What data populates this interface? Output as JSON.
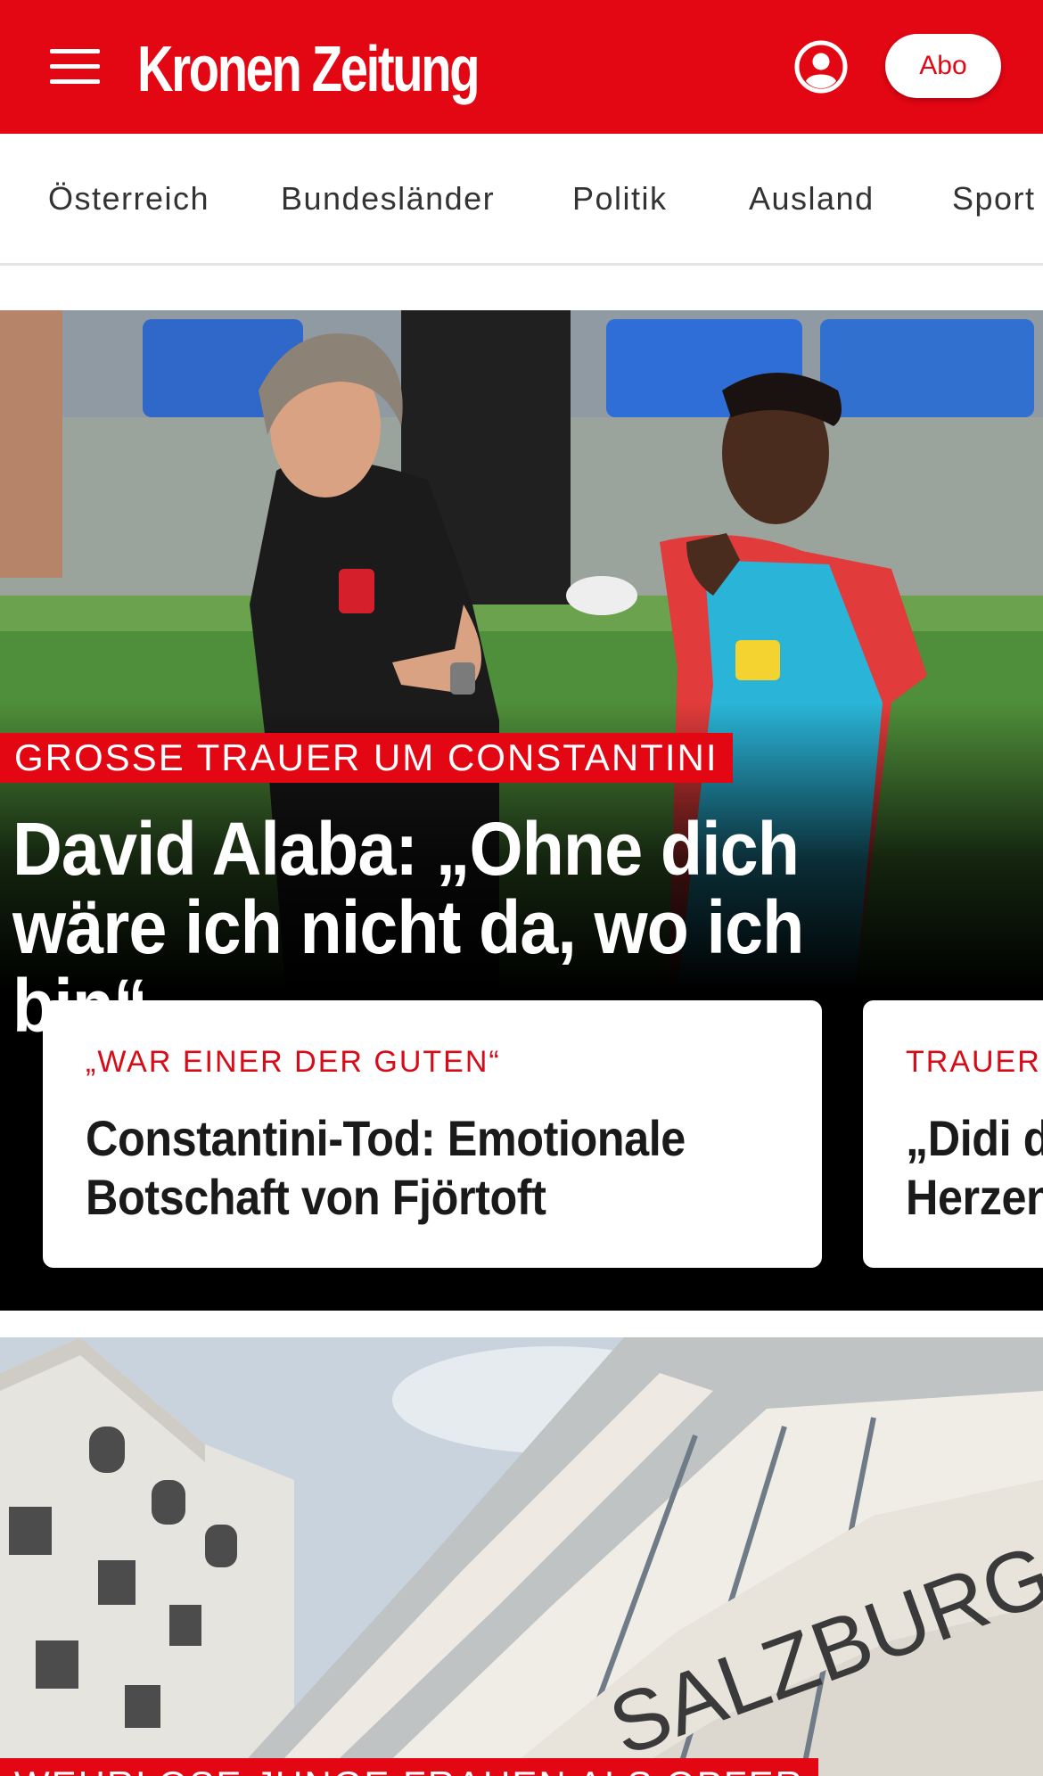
{
  "header": {
    "logo_text": "Kronen Zeitung",
    "abo_label": "Abo"
  },
  "nav": {
    "items": [
      {
        "label": "Österreich"
      },
      {
        "label": "Bundesländer"
      },
      {
        "label": "Politik"
      },
      {
        "label": "Ausland"
      },
      {
        "label": "Sport"
      }
    ]
  },
  "hero": {
    "kicker": "GROSSE TRAUER UM CONSTANTINI",
    "headline": "David Alaba: „Ohne dich wäre ich nicht da, wo ich bin“",
    "cards": [
      {
        "kicker": "„WAR EINER DER GUTEN“",
        "title": "Constantini-Tod: Emotionale\nBotschaft von Fjörtoft"
      },
      {
        "kicker": "TRAUER",
        "title": "„Didi d\nHerzen"
      }
    ]
  },
  "teaser2": {
    "kicker": "WEHRLOSE JUNGE FRAUEN ALS OPFER",
    "sign_text": "SALZBURG"
  },
  "colors": {
    "brand_red": "#e30613",
    "kicker_red": "#d80c18"
  },
  "icons": [
    "menu-icon",
    "user-icon"
  ]
}
